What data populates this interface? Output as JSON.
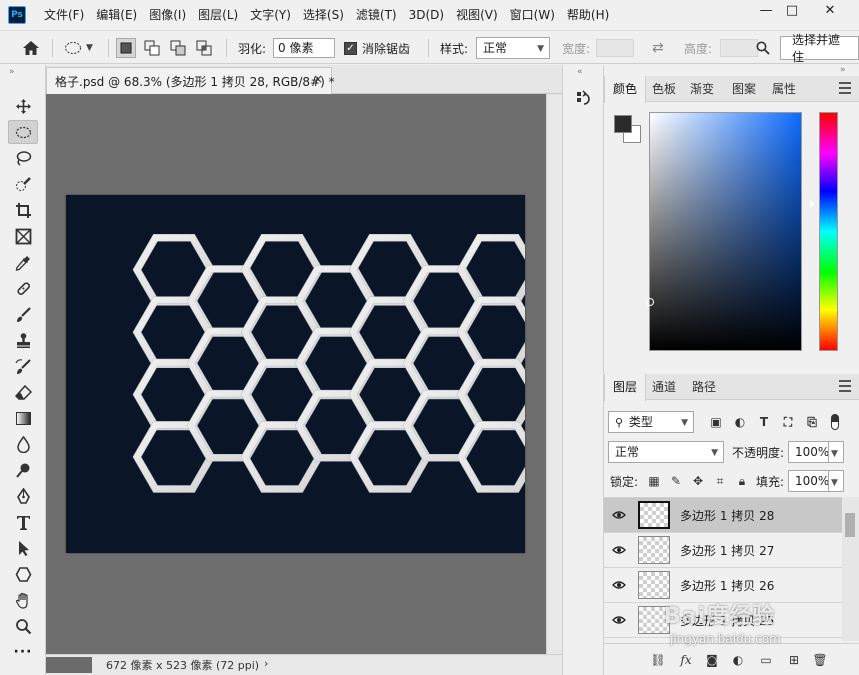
{
  "app": {
    "logo": "Ps",
    "menu": [
      "文件(F)",
      "编辑(E)",
      "图像(I)",
      "图层(L)",
      "文字(Y)",
      "选择(S)",
      "滤镜(T)",
      "3D(D)",
      "视图(V)",
      "窗口(W)",
      "帮助(H)"
    ],
    "window_buttons": {
      "minimize": "—",
      "restore": "□",
      "close": "✕"
    }
  },
  "options": {
    "feather_label": "羽化:",
    "feather_value": "0 像素",
    "antialias_label": "消除锯齿",
    "antialias_checked": true,
    "style_label": "样式:",
    "style_value": "正常",
    "width_label": "宽度:",
    "height_label": "高度:",
    "select_mask_label": "选择并遮住"
  },
  "document": {
    "tab_title": "格子.psd @ 68.3% (多边形 1 拷贝 28, RGB/8#) *",
    "tab_close": "×",
    "canvas_bg": "#0a1628",
    "status_info": "672 像素 x 523 像素 (72 ppi)",
    "status_arrow": "›"
  },
  "color_panel": {
    "tabs": [
      "颜色",
      "色板",
      "渐变",
      "图案",
      "属性"
    ],
    "foreground": "#2b2b2b",
    "background": "#ffffff"
  },
  "layers_panel": {
    "tabs": [
      "图层",
      "通道",
      "路径"
    ],
    "filter_type": "类型",
    "blend_mode": "正常",
    "opacity_label": "不透明度:",
    "opacity_value": "100%",
    "lock_label": "锁定:",
    "fill_label": "填充:",
    "fill_value": "100%",
    "layers": [
      {
        "name": "多边形 1 拷贝 28",
        "selected": true
      },
      {
        "name": "多边形 1 拷贝 27",
        "selected": false
      },
      {
        "name": "多边形 1 拷贝 26",
        "selected": false
      },
      {
        "name": "多边形 1 拷贝 25",
        "selected": false
      }
    ]
  },
  "watermark": {
    "text": "Bai度经验",
    "url": "jingyan.baidu.com"
  }
}
